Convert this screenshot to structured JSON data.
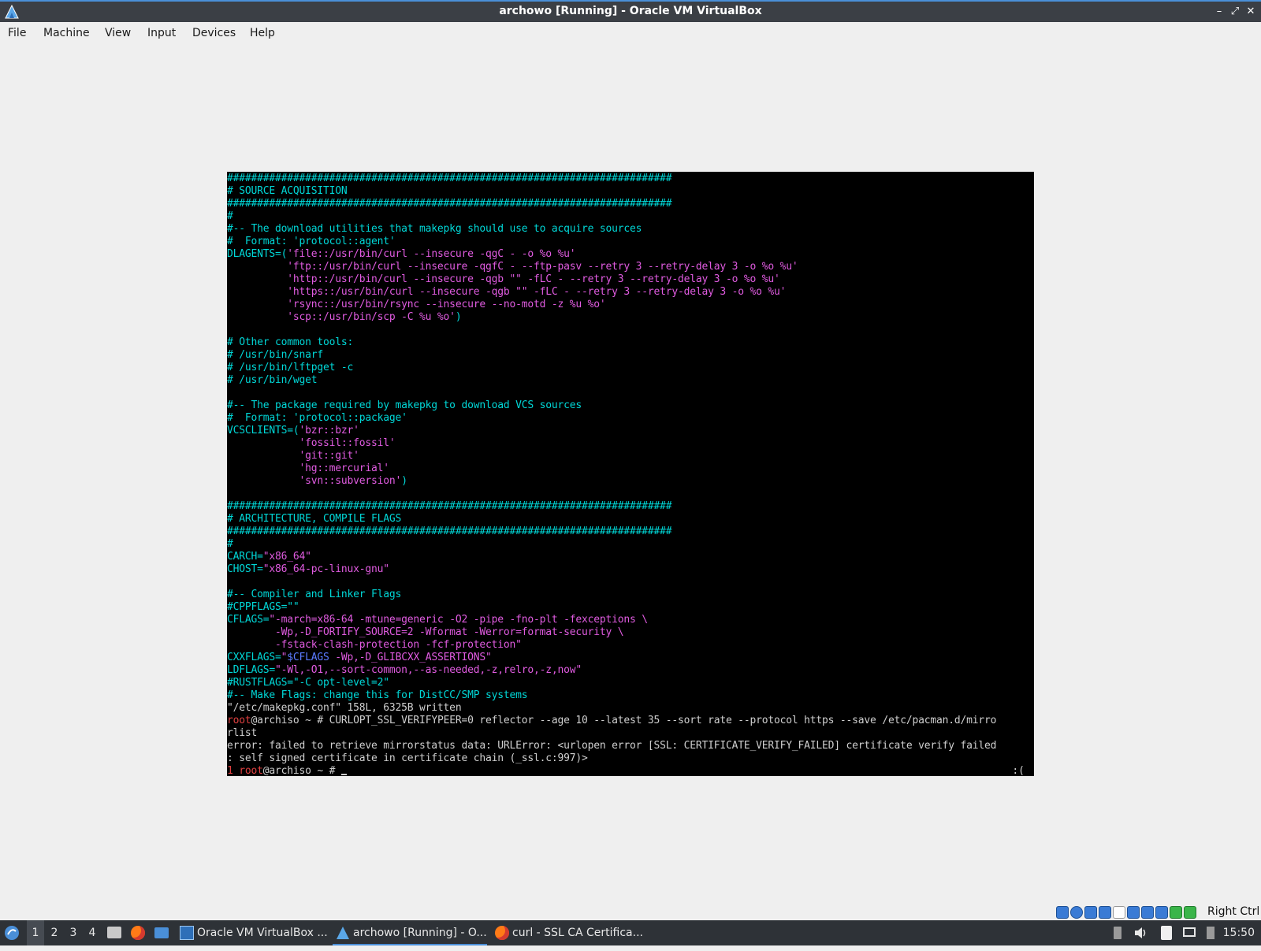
{
  "window": {
    "title": "archowo [Running] - Oracle VM VirtualBox",
    "controls": {
      "minimize": "–",
      "maximize": "⤢",
      "close": "✕"
    }
  },
  "menu": [
    "File",
    "Machine",
    "View",
    "Input",
    "Devices",
    "Help"
  ],
  "terminal": {
    "lines": [
      [
        [
          "c",
          "##########################################################################"
        ]
      ],
      [
        [
          "c",
          "# SOURCE ACQUISITION"
        ]
      ],
      [
        [
          "c",
          "##########################################################################"
        ]
      ],
      [
        [
          "c",
          "#"
        ]
      ],
      [
        [
          "c",
          "#-- The download utilities that makepkg should use to acquire sources"
        ]
      ],
      [
        [
          "c",
          "#  Format: 'protocol::agent'"
        ]
      ],
      [
        [
          "c",
          "DLAGENTS=("
        ],
        [
          "m",
          "'file::/usr/bin/curl --insecure -qgC - -o %o %u'"
        ]
      ],
      [
        [
          "m",
          "          'ftp::/usr/bin/curl --insecure -qgfC - --ftp-pasv --retry 3 --retry-delay 3 -o %o %u'"
        ]
      ],
      [
        [
          "m",
          "          'http::/usr/bin/curl --insecure -qgb \"\" -fLC - --retry 3 --retry-delay 3 -o %o %u'"
        ]
      ],
      [
        [
          "m",
          "          'https::/usr/bin/curl --insecure -qgb \"\" -fLC - --retry 3 --retry-delay 3 -o %o %u'"
        ]
      ],
      [
        [
          "m",
          "          'rsync::/usr/bin/rsync --insecure --no-motd -z %u %o'"
        ]
      ],
      [
        [
          "m",
          "          'scp::/usr/bin/scp -C %u %o'"
        ],
        [
          "c",
          ")"
        ]
      ],
      [
        [
          "g",
          ""
        ]
      ],
      [
        [
          "c",
          "# Other common tools:"
        ]
      ],
      [
        [
          "c",
          "# /usr/bin/snarf"
        ]
      ],
      [
        [
          "c",
          "# /usr/bin/lftpget -c"
        ]
      ],
      [
        [
          "c",
          "# /usr/bin/wget"
        ]
      ],
      [
        [
          "g",
          ""
        ]
      ],
      [
        [
          "c",
          "#-- The package required by makepkg to download VCS sources"
        ]
      ],
      [
        [
          "c",
          "#  Format: 'protocol::package'"
        ]
      ],
      [
        [
          "c",
          "VCSCLIENTS=("
        ],
        [
          "m",
          "'bzr::bzr'"
        ]
      ],
      [
        [
          "m",
          "            'fossil::fossil'"
        ]
      ],
      [
        [
          "m",
          "            'git::git'"
        ]
      ],
      [
        [
          "m",
          "            'hg::mercurial'"
        ]
      ],
      [
        [
          "m",
          "            'svn::subversion'"
        ],
        [
          "c",
          ")"
        ]
      ],
      [
        [
          "g",
          ""
        ]
      ],
      [
        [
          "c",
          "##########################################################################"
        ]
      ],
      [
        [
          "c",
          "# ARCHITECTURE, COMPILE FLAGS"
        ]
      ],
      [
        [
          "c",
          "##########################################################################"
        ]
      ],
      [
        [
          "c",
          "#"
        ]
      ],
      [
        [
          "c",
          "CARCH="
        ],
        [
          "m",
          "\"x86_64\""
        ]
      ],
      [
        [
          "c",
          "CHOST="
        ],
        [
          "m",
          "\"x86_64-pc-linux-gnu\""
        ]
      ],
      [
        [
          "g",
          ""
        ]
      ],
      [
        [
          "c",
          "#-- Compiler and Linker Flags"
        ]
      ],
      [
        [
          "c",
          "#CPPFLAGS=\"\""
        ]
      ],
      [
        [
          "c",
          "CFLAGS="
        ],
        [
          "m",
          "\"-march=x86-64 -mtune=generic -O2 -pipe -fno-plt -fexceptions \\"
        ]
      ],
      [
        [
          "m",
          "        -Wp,-D_FORTIFY_SOURCE=2 -Wformat -Werror=format-security \\"
        ]
      ],
      [
        [
          "m",
          "        -fstack-clash-protection -fcf-protection\""
        ]
      ],
      [
        [
          "c",
          "CXXFLAGS="
        ],
        [
          "m",
          "\""
        ],
        [
          "b",
          "$CFLAGS"
        ],
        [
          "m",
          " -Wp,-D_GLIBCXX_ASSERTIONS\""
        ]
      ],
      [
        [
          "c",
          "LDFLAGS="
        ],
        [
          "m",
          "\"-Wl,-O1,--sort-common,--as-needed,-z,relro,-z,now\""
        ]
      ],
      [
        [
          "c",
          "#RUSTFLAGS=\"-C opt-level=2\""
        ]
      ],
      [
        [
          "c",
          "#-- Make Flags: change this for DistCC/SMP systems"
        ]
      ],
      [
        [
          "g",
          "\"/etc/makepkg.conf\" 158L, 6325B written"
        ]
      ],
      [
        [
          "r",
          "root"
        ],
        [
          "g",
          "@archiso ~ # CURLOPT_SSL_VERIFYPEER=0 reflector --age 10 --latest 35 --sort rate --protocol https --save /etc/pacman.d/mirro"
        ]
      ],
      [
        [
          "g",
          "rlist"
        ]
      ],
      [
        [
          "g",
          "error: failed to retrieve mirrorstatus data: URLError: <urlopen error [SSL: CERTIFICATE_VERIFY_FAILED] certificate verify failed"
        ]
      ],
      [
        [
          "g",
          ": self signed certificate in certificate chain (_ssl.c:997)>"
        ]
      ],
      [
        [
          "r",
          "1 root"
        ],
        [
          "g",
          "@archiso ~ # "
        ]
      ]
    ],
    "status_face": ":("
  },
  "statusbar": {
    "host_key": "Right Ctrl"
  },
  "taskbar": {
    "workspaces": [
      "1",
      "2",
      "3",
      "4"
    ],
    "tasks": [
      {
        "label": "Oracle VM VirtualBox ...",
        "icon": "virtualbox-icon"
      },
      {
        "label": "archowo [Running] - O...",
        "icon": "virtualbox-vm-icon"
      },
      {
        "label": "curl - SSL CA Certifica...",
        "icon": "firefox-icon"
      }
    ],
    "clock": "15:50"
  },
  "colors": {
    "comment": "#00d7d7",
    "string": "#e05be0",
    "text": "#cfcfcf",
    "root": "#e04040",
    "variable": "#5b7bff"
  }
}
